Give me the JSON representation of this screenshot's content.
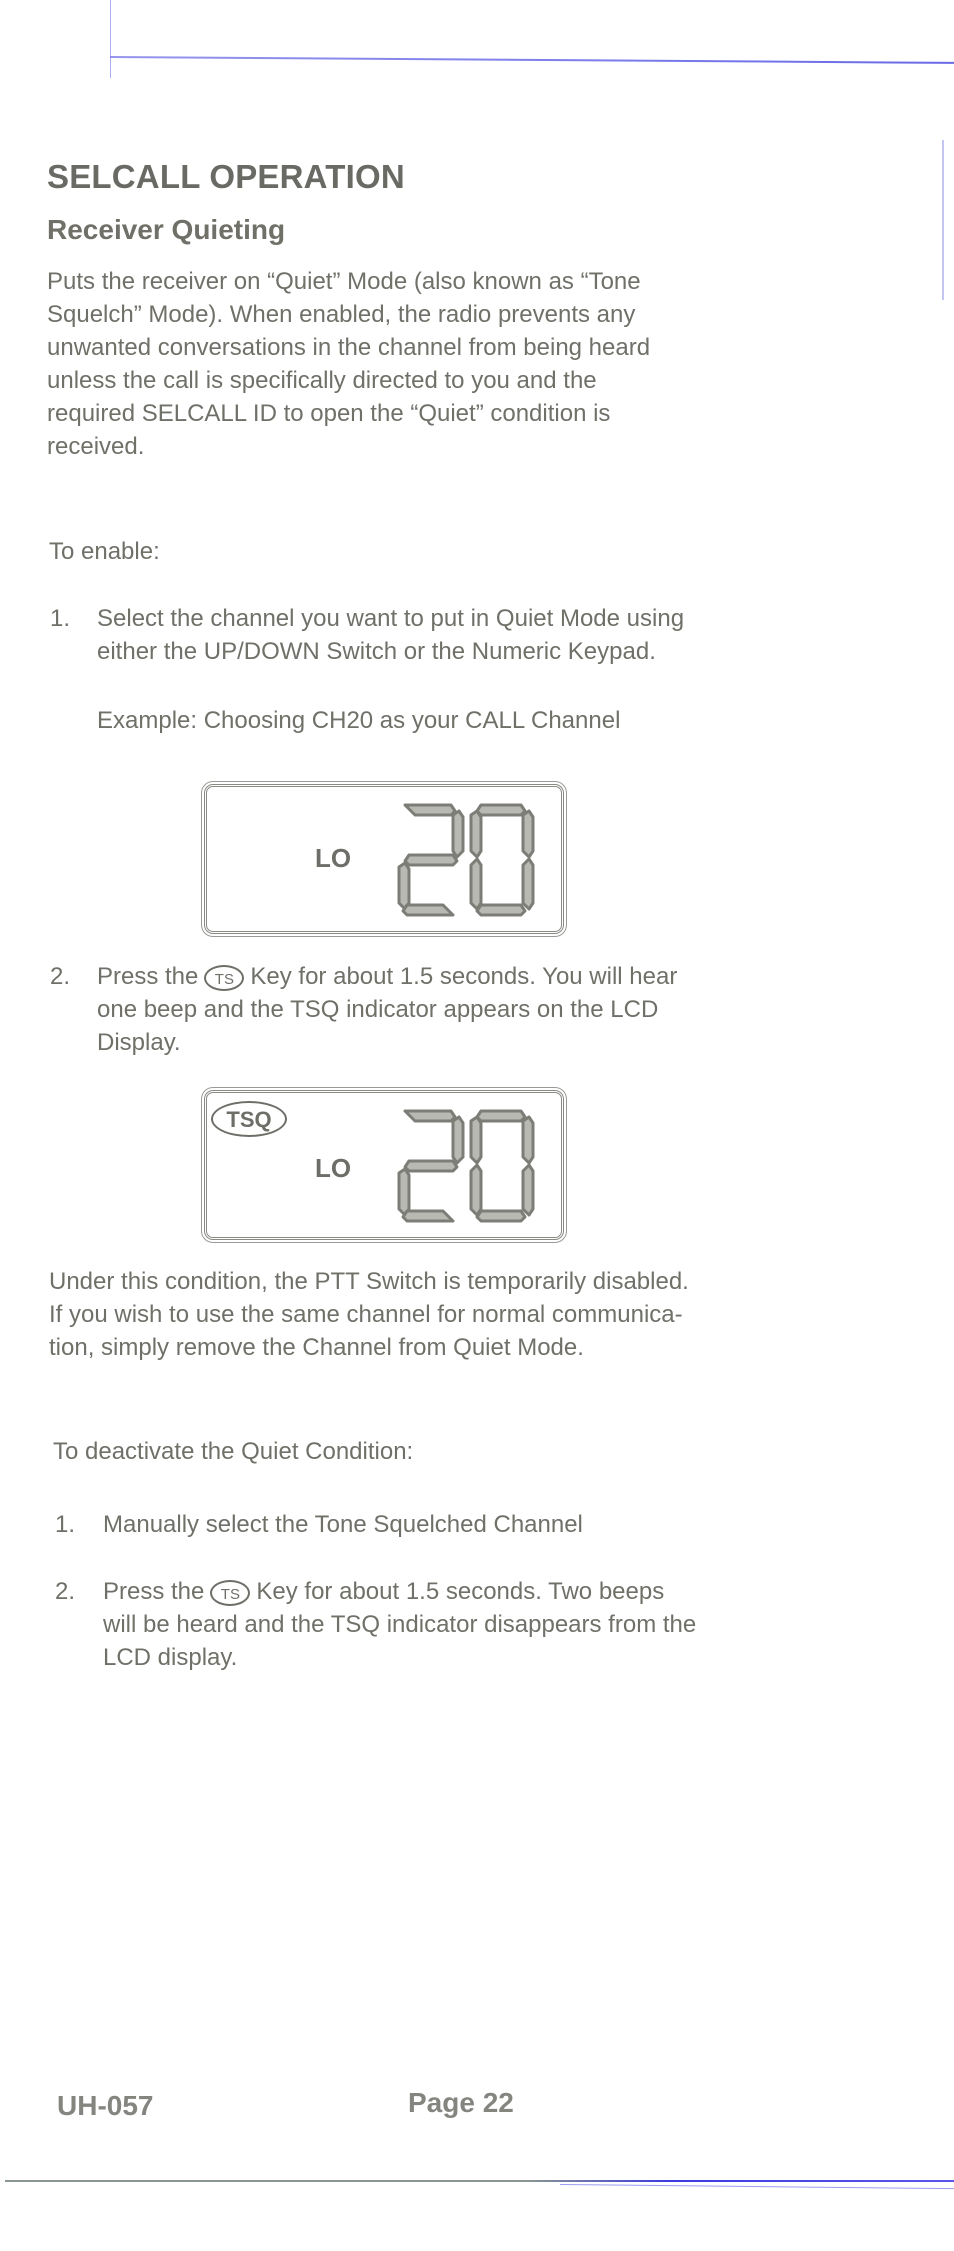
{
  "document": {
    "title": "SELCALL OPERATION",
    "subtitle": "Receiver Quieting",
    "intro_lines": [
      "Puts the receiver on “Quiet” Mode (also known as “Tone",
      "Squelch” Mode). When enabled, the radio prevents any",
      "unwanted conversations in the channel from being heard",
      "unless the call is specifically directed to you and the",
      "required SELCALL ID to open the “Quiet” condition is",
      "received."
    ],
    "enable": {
      "heading": "To enable:",
      "steps": [
        {
          "number": "1.",
          "lines": [
            "Select the channel you want to put in Quiet Mode using",
            "either the UP/DOWN Switch or the Numeric Keypad."
          ],
          "example": "Example: Choosing CH20 as your CALL Channel",
          "lcd": {
            "power": "LO",
            "channel": "20",
            "tsq_indicator": ""
          }
        },
        {
          "number": "2.",
          "line1_before": "Press the",
          "key_label": "TS",
          "line1_after": "Key for about 1.5 seconds. You will hear",
          "lines": [
            "one beep and the TSQ indicator appears on the LCD",
            "Display."
          ],
          "lcd": {
            "power": "LO",
            "channel": "20",
            "tsq_indicator": "TSQ"
          }
        }
      ]
    },
    "note_lines": [
      "Under this condition, the PTT Switch is temporarily disabled.",
      "If you wish to use the same channel for normal communica-",
      "tion, simply remove the Channel from Quiet Mode."
    ],
    "deactivate": {
      "heading": "To deactivate the Quiet Condition:",
      "steps": [
        {
          "number": "1.",
          "lines": [
            "Manually select the Tone Squelched Channel"
          ]
        },
        {
          "number": "2.",
          "line1_before": "Press the",
          "key_label": "TS",
          "line1_after": "Key for about 1.5 seconds. Two beeps",
          "lines": [
            "will be heard and the TSQ indicator disappears from the",
            "LCD display."
          ]
        }
      ]
    },
    "footer": {
      "model": "UH-057",
      "page": "Page 22"
    },
    "colors": {
      "text": "#707069",
      "crop_mark": "#5a5ae6"
    }
  }
}
